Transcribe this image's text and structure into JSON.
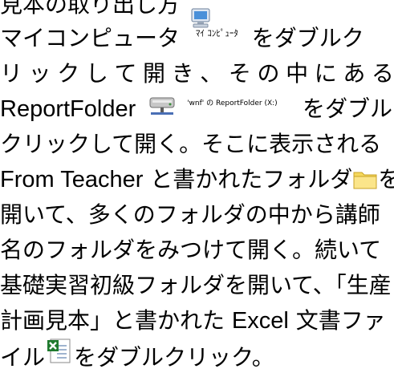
{
  "heading": "見本の取り出し方",
  "paragraph": {
    "l1_a": "マイコンピュータ",
    "l1_icon_caption": "ﾏｲ ｺﾝﾋﾟｭｰﾀ",
    "l1_b": "をダブルク",
    "l2_chars": [
      "リ",
      "ッ",
      "ク",
      "し",
      "て",
      "開",
      "き",
      "、",
      "そ",
      "の",
      "中",
      "に",
      "あ",
      "る"
    ],
    "l3_a": "ReportFolder",
    "l3_drive_caption": "'wnf' の ReportFolder (X:)",
    "l3_b": "をダブル",
    "l4": "クリックして開く。そこに表示される",
    "l5_a": "From Teacher",
    "l5_b": " と書かれたフォルダ",
    "l5_c": "を",
    "l6": "開いて、多くのフォルダの中から講師",
    "l7": "名のフォルダをみつけて開く。続いて",
    "l8": "基礎実習初級フォルダを開いて、「生産",
    "l9_a": "計画見本」と書かれた ",
    "l9_b": "Excel",
    "l9_c": " 文書ファ",
    "l10_a": "イル",
    "l10_b": "をダブルクリック。"
  },
  "icons": {
    "computer": "my-computer-icon",
    "network_drive": "network-drive-icon",
    "folder": "folder-icon",
    "excel": "excel-file-icon"
  },
  "colors": {
    "folder_yellow": "#f5d85c",
    "excel_green": "#1f7a2e",
    "monitor_blue": "#4a90d9"
  }
}
